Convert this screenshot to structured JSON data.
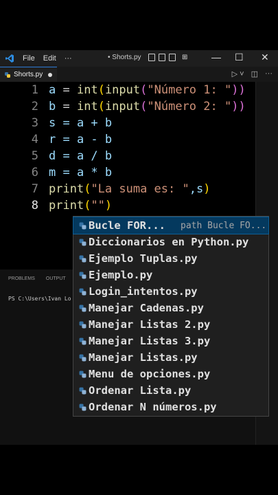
{
  "titlebar": {
    "menu": [
      "File",
      "Edit",
      "···"
    ],
    "file_name": "• Shorts.py",
    "minimize": "—",
    "maximize": "☐",
    "close": "✕"
  },
  "tab": {
    "name": "Shorts.py"
  },
  "editor": {
    "line_numbers": [
      "1",
      "2",
      "3",
      "4",
      "5",
      "6",
      "7",
      "8"
    ],
    "lines": [
      {
        "v": "a",
        "rest1": " = ",
        "f": "int",
        "p1": "(",
        "f2": "input",
        "p2": "(",
        "s": "\"Número 1: \"",
        "p3": "))"
      },
      {
        "v": "b",
        "rest1": " = ",
        "f": "int",
        "p1": "(",
        "f2": "input",
        "p2": "(",
        "s": "\"Número 2: \"",
        "p3": "))"
      },
      {
        "text": "s = a + b"
      },
      {
        "text": "r = a - b"
      },
      {
        "text": "d = a / b"
      },
      {
        "text": "m = a * b"
      },
      {
        "f": "print",
        "p1": "(",
        "s": "\"La suma es: \"",
        "rest": ",s",
        "p2": ")"
      },
      {
        "f": "print",
        "p1": "(",
        "s": "\"\"",
        "p2": ")"
      }
    ]
  },
  "panel": {
    "tabs": [
      "PROBLEMS",
      "OUTPUT"
    ],
    "terminal": "PS C:\\Users\\Ivan Lo"
  },
  "suggestions": [
    {
      "label": "Bucle FOR...",
      "detail": "path Bucle FO..."
    },
    {
      "label": "Diccionarios en Python.py"
    },
    {
      "label": "Ejemplo Tuplas.py"
    },
    {
      "label": "Ejemplo.py"
    },
    {
      "label": "Login_intentos.py"
    },
    {
      "label": "Manejar Cadenas.py"
    },
    {
      "label": "Manejar Listas 2.py"
    },
    {
      "label": "Manejar Listas 3.py"
    },
    {
      "label": "Manejar Listas.py"
    },
    {
      "label": "Menu de opciones.py"
    },
    {
      "label": "Ordenar Lista.py"
    },
    {
      "label": "Ordenar N números.py"
    }
  ],
  "colors": {
    "accent": "#2d7bd6",
    "selection": "#04395e",
    "string": "#ce9178",
    "function": "#dcdcaa",
    "variable": "#9cdcfe"
  }
}
